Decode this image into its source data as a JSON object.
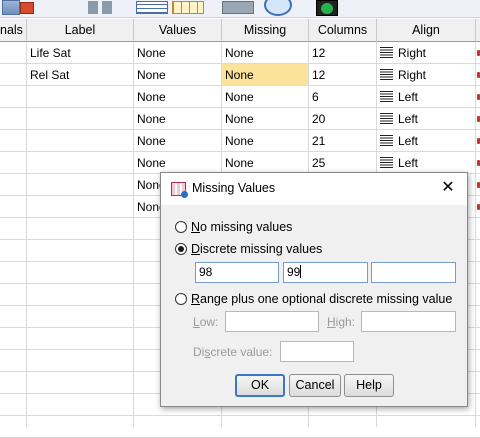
{
  "grid": {
    "columns": [
      "nals",
      "Label",
      "Values",
      "Missing",
      "Columns",
      "Align"
    ],
    "rows": [
      {
        "label": "Life Sat",
        "values": "None",
        "missing": "None",
        "columns": "12",
        "align": "Right"
      },
      {
        "label": "Rel Sat",
        "values": "None",
        "missing": "None",
        "columns": "12",
        "align": "Right"
      },
      {
        "label": "",
        "values": "None",
        "missing": "None",
        "columns": "6",
        "align": "Left"
      },
      {
        "label": "",
        "values": "None",
        "missing": "None",
        "columns": "20",
        "align": "Left"
      },
      {
        "label": "",
        "values": "None",
        "missing": "None",
        "columns": "21",
        "align": "Left"
      },
      {
        "label": "",
        "values": "None",
        "missing": "None",
        "columns": "25",
        "align": "Left"
      },
      {
        "label": "",
        "values": "None",
        "missing": "",
        "columns": "",
        "align": ""
      },
      {
        "label": "",
        "values": "None",
        "missing": "",
        "columns": "",
        "align": ""
      }
    ],
    "highlight_color": "#fbe39a"
  },
  "dialog": {
    "title": "Missing Values",
    "option_none_pre": "",
    "option_none_u": "N",
    "option_none_post": "o missing values",
    "option_discrete_pre": "",
    "option_discrete_u": "D",
    "option_discrete_post": "iscrete missing values",
    "discrete_values": [
      "98",
      "99",
      ""
    ],
    "option_range_pre": "",
    "option_range_u": "R",
    "option_range_post": "ange plus one optional discrete missing value",
    "low_label_u": "L",
    "low_label_post": "ow:",
    "high_label_u": "H",
    "high_label_post": "igh:",
    "discrete_value_label_pre": "Di",
    "discrete_value_label_u": "s",
    "discrete_value_label_post": "crete value:",
    "ok_label": "OK",
    "cancel_label": "Cancel",
    "help_label": "Help",
    "selected_option": "discrete"
  },
  "icons": [
    "close-icon",
    "missing-values-dialog-icon",
    "align-right-icon",
    "align-left-icon"
  ]
}
